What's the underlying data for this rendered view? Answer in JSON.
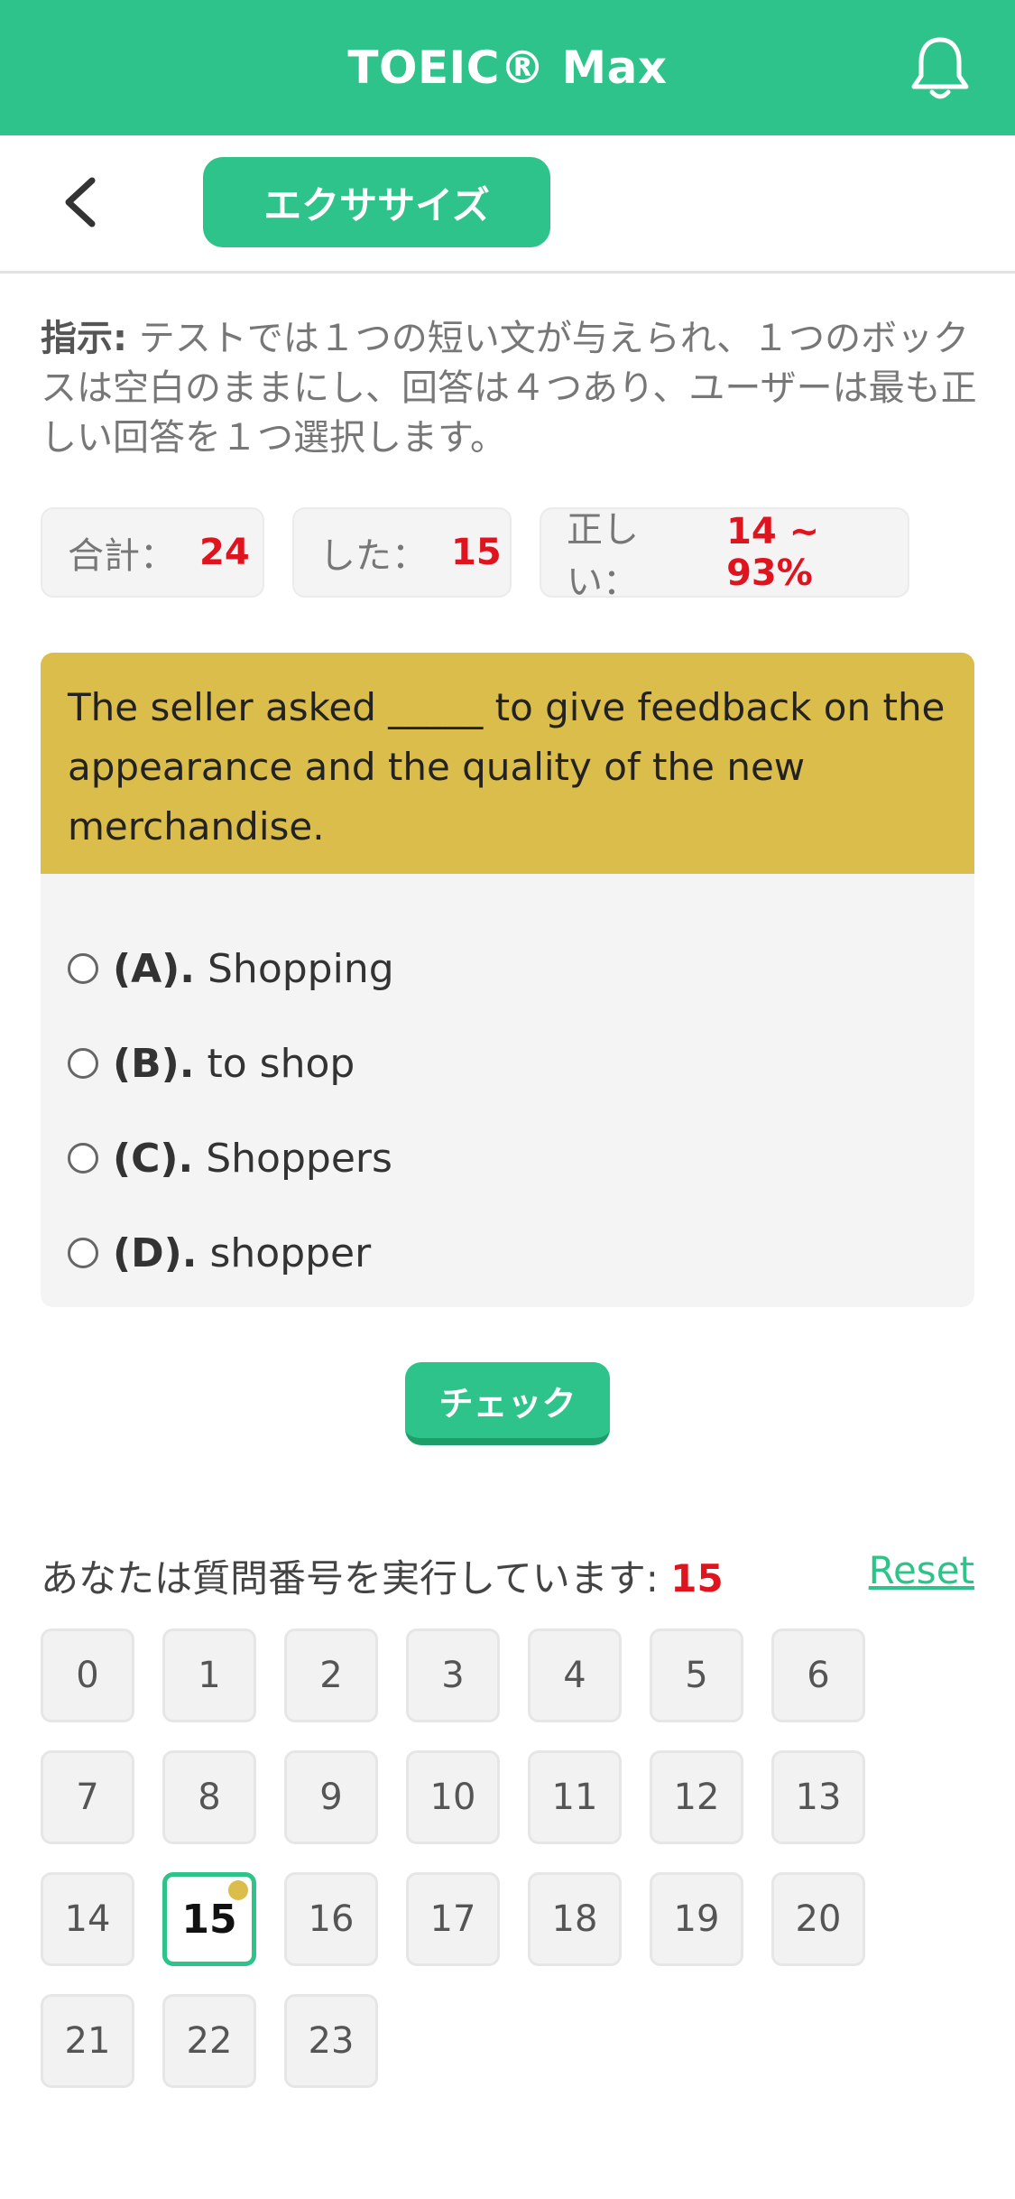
{
  "header": {
    "title": "TOEIC® Max"
  },
  "subbar": {
    "tab_label": "エクササイズ"
  },
  "instructions": {
    "label": "指示:",
    "text": " テストでは１つの短い文が与えられ、１つのボックスは空白のままにし、回答は４つあり、ユーザーは最も正しい回答を１つ選択します。"
  },
  "stats": {
    "total_label": "合計：",
    "total_value": "24",
    "done_label": "した：",
    "done_value": "15",
    "correct_label": "正しい：",
    "correct_value": "14 ~ 93%"
  },
  "question": {
    "text": "The seller asked _____ to give feedback on the appearance and the quality of the new merchandise.",
    "options": [
      {
        "key": "(A).",
        "text": "Shopping"
      },
      {
        "key": "(B).",
        "text": "to shop"
      },
      {
        "key": "(C).",
        "text": "Shoppers"
      },
      {
        "key": "(D).",
        "text": "shopper"
      }
    ]
  },
  "check_label": "チェック",
  "progress": {
    "label": "あなたは質問番号を実行しています:",
    "current": "15",
    "reset_label": "Reset"
  },
  "numbers": [
    "0",
    "1",
    "2",
    "3",
    "4",
    "5",
    "6",
    "7",
    "8",
    "9",
    "10",
    "11",
    "12",
    "13",
    "14",
    "15",
    "16",
    "17",
    "18",
    "19",
    "20",
    "21",
    "22",
    "23"
  ],
  "colors": {
    "brand": "#2ec38a",
    "question_bg": "#dbbd4b",
    "accent_red": "#e0141e"
  }
}
